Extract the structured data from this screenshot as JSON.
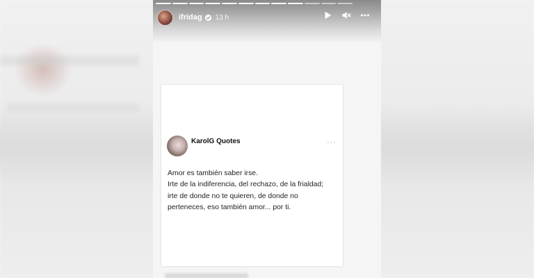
{
  "story": {
    "progress_total": 12,
    "progress_done": 9,
    "user": {
      "username": "ifridag",
      "verified": true,
      "time_ago": "13 h"
    },
    "controls": [
      {
        "name": "play-icon",
        "symbol": "play"
      },
      {
        "name": "mute-icon",
        "symbol": "mute"
      },
      {
        "name": "more-options-icon",
        "symbol": "more"
      }
    ]
  },
  "post": {
    "author": "KarolG Quotes",
    "more_label": "···",
    "lines": [
      "Amor es también saber irse.",
      "Irte de la indiferencia, del rechazo, de la frialdad;",
      "irte de donde no te quieren, de donde no",
      "perteneces, eso también amor... por ti."
    ]
  },
  "colors": {
    "header_gradient_top": "#8a8a8a",
    "card_background": "#ffffff",
    "page_background": "#f4f4f4"
  }
}
